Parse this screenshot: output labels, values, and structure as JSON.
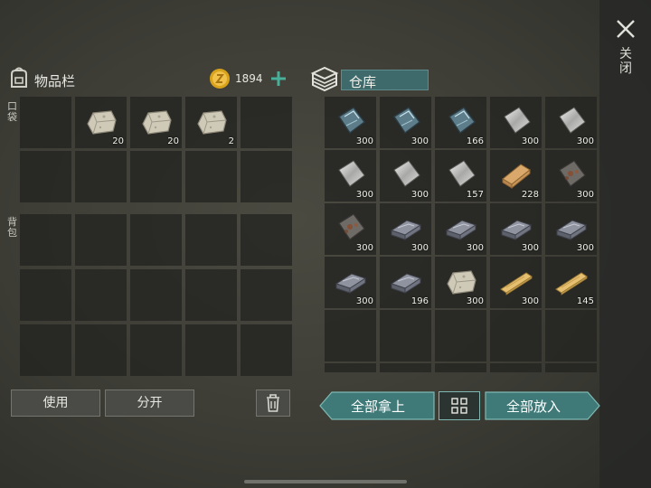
{
  "close": {
    "label": "关闭",
    "icon": "close-icon"
  },
  "inventory": {
    "title": "物品栏",
    "pocket_label": "口袋",
    "backpack_label": "背包",
    "coins": "1894",
    "pocket_slots": [
      {
        "item": "empty",
        "count": ""
      },
      {
        "item": "stone",
        "count": "20"
      },
      {
        "item": "stone",
        "count": "20"
      },
      {
        "item": "stone",
        "count": "2"
      },
      {
        "item": "empty",
        "count": ""
      },
      {
        "item": "empty",
        "count": ""
      },
      {
        "item": "empty",
        "count": ""
      },
      {
        "item": "empty",
        "count": ""
      },
      {
        "item": "empty",
        "count": ""
      },
      {
        "item": "empty",
        "count": ""
      }
    ],
    "backpack_slots": [
      {
        "item": "empty",
        "count": ""
      },
      {
        "item": "empty",
        "count": ""
      },
      {
        "item": "empty",
        "count": ""
      },
      {
        "item": "empty",
        "count": ""
      },
      {
        "item": "empty",
        "count": ""
      },
      {
        "item": "empty",
        "count": ""
      },
      {
        "item": "empty",
        "count": ""
      },
      {
        "item": "empty",
        "count": ""
      },
      {
        "item": "empty",
        "count": ""
      },
      {
        "item": "empty",
        "count": ""
      },
      {
        "item": "empty",
        "count": ""
      },
      {
        "item": "empty",
        "count": ""
      },
      {
        "item": "empty",
        "count": ""
      },
      {
        "item": "empty",
        "count": ""
      },
      {
        "item": "empty",
        "count": ""
      }
    ],
    "use_label": "使用",
    "split_label": "分开"
  },
  "storage": {
    "title": "仓库",
    "slots": [
      {
        "item": "glass",
        "count": "300"
      },
      {
        "item": "glass",
        "count": "300"
      },
      {
        "item": "glass",
        "count": "166"
      },
      {
        "item": "metal_sheet",
        "count": "300"
      },
      {
        "item": "metal_sheet",
        "count": "300"
      },
      {
        "item": "metal_sheet",
        "count": "300"
      },
      {
        "item": "metal_sheet",
        "count": "300"
      },
      {
        "item": "metal_sheet",
        "count": "157"
      },
      {
        "item": "wood_block",
        "count": "228"
      },
      {
        "item": "rusty_sheet",
        "count": "300"
      },
      {
        "item": "rusty_sheet",
        "count": "300"
      },
      {
        "item": "iron_ingot",
        "count": "300"
      },
      {
        "item": "iron_ingot",
        "count": "300"
      },
      {
        "item": "iron_ingot",
        "count": "300"
      },
      {
        "item": "iron_ingot",
        "count": "300"
      },
      {
        "item": "iron_ingot",
        "count": "300"
      },
      {
        "item": "iron_ingot",
        "count": "196"
      },
      {
        "item": "stone",
        "count": "300"
      },
      {
        "item": "wood_plank",
        "count": "300"
      },
      {
        "item": "wood_plank",
        "count": "145"
      },
      {
        "item": "empty",
        "count": ""
      },
      {
        "item": "empty",
        "count": ""
      },
      {
        "item": "empty",
        "count": ""
      },
      {
        "item": "empty",
        "count": ""
      },
      {
        "item": "empty",
        "count": ""
      },
      {
        "item": "empty",
        "count": ""
      },
      {
        "item": "empty",
        "count": ""
      },
      {
        "item": "empty",
        "count": ""
      },
      {
        "item": "empty",
        "count": ""
      },
      {
        "item": "empty",
        "count": ""
      }
    ],
    "take_all_label": "全部拿上",
    "put_all_label": "全部放入"
  },
  "colors": {
    "accent": "#3f7a78",
    "coin": "#d9a21b",
    "plus": "#46b09a"
  }
}
